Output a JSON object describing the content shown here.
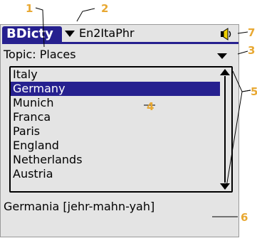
{
  "app": {
    "title": "BDicty",
    "dictionary_selected": "En2ItaPhr"
  },
  "topic": {
    "label": "Topic: Places"
  },
  "list": {
    "items": [
      "Italy",
      "Germany",
      "Munich",
      "Franca",
      "Paris",
      "England",
      "Netherlands",
      "Austria"
    ],
    "selected_index": 1
  },
  "translation": {
    "text": "Germania [jehr-mahn-yah]"
  },
  "callouts": [
    "1",
    "2",
    "3",
    "4",
    "5",
    "6",
    "7"
  ],
  "colors": {
    "accent": "#26208f",
    "callout": "#e8a832",
    "background": "#e4e4e4"
  },
  "icons": {
    "speaker": "speaker-icon",
    "dropdown": "triangle-down-icon",
    "scroll_up": "arrow-up-icon",
    "scroll_down": "arrow-down-icon"
  }
}
